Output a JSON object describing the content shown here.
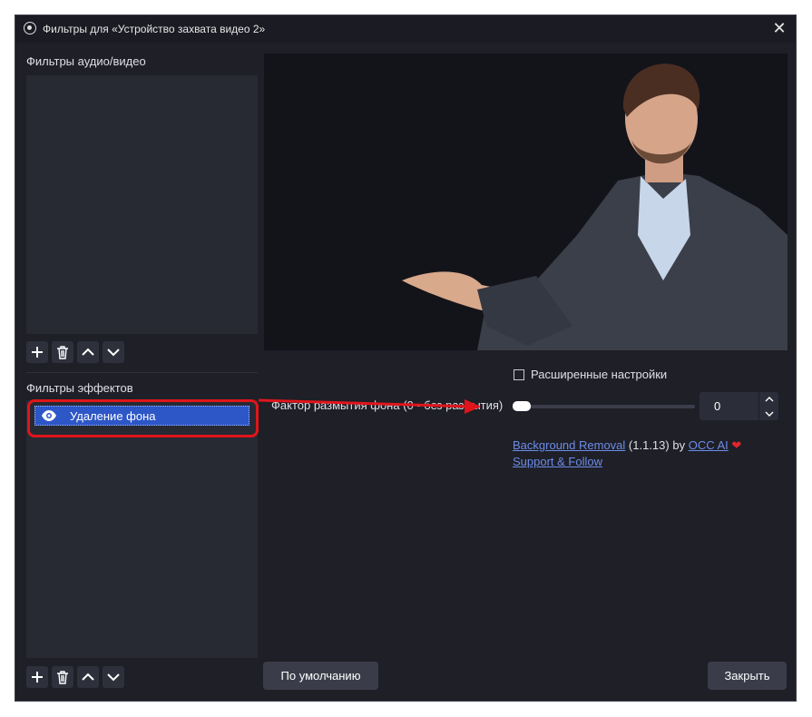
{
  "window": {
    "title": "Фильтры для «Устройство захвата видео 2»"
  },
  "left_panel": {
    "av_filters_label": "Фильтры аудио/видео",
    "effect_filters_label": "Фильтры эффектов",
    "effect_filters": [
      {
        "label": "Удаление фона",
        "visible": true,
        "selected": true
      }
    ]
  },
  "settings": {
    "advanced_checkbox_label": "Расширенные настройки",
    "advanced_checked": false,
    "blur_label": "Фактор размытия фона (0 - без размытия)",
    "blur_value": "0",
    "blur_slider_fraction": 0
  },
  "plugin_info": {
    "name_link": "Background Removal",
    "version": "(1.1.13) by",
    "author_link": "OCC AI",
    "support_link": "Support & Follow"
  },
  "buttons": {
    "defaults": "По умолчанию",
    "close": "Закрыть"
  },
  "colors": {
    "accent_selection": "#2d56c7",
    "annotation_red": "#e0151b",
    "link": "#6d8ce8"
  }
}
